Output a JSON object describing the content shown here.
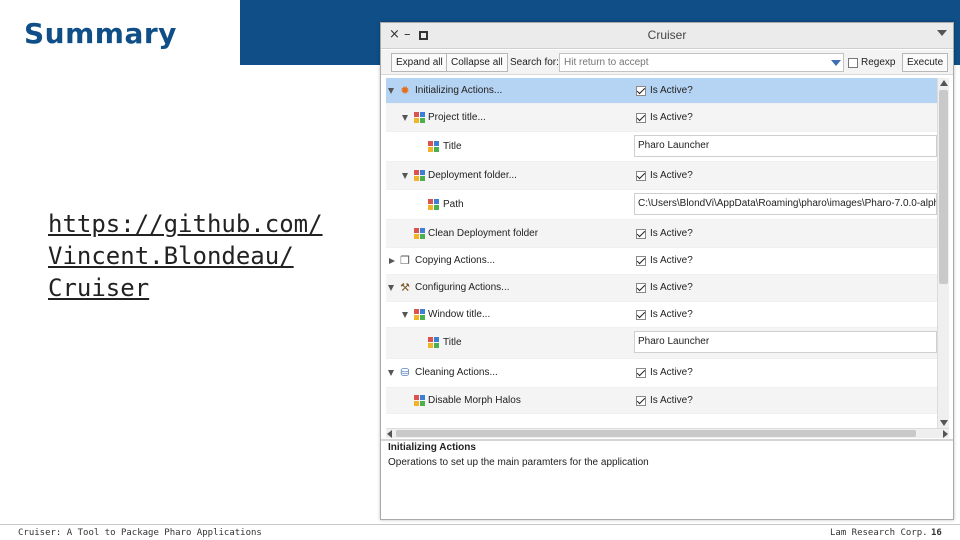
{
  "slide": {
    "title": "Summary",
    "link_lines": [
      "https://github.com/",
      "Vincent.Blondeau/",
      "Cruiser"
    ],
    "footer_left": "Cruiser: A Tool to Package Pharo Applications",
    "footer_company": "Lam Research Corp.",
    "page_number": "16",
    "header_color": "#0f4e86"
  },
  "window": {
    "title": "Cruiser",
    "close_glyph": "×",
    "minimize_glyph": "–",
    "toolbar": {
      "expand_all": "Expand all",
      "collapse_all": "Collapse all",
      "search_label": "Search for:",
      "search_placeholder": "Hit return to accept",
      "regexp_label": "Regexp",
      "execute": "Execute"
    },
    "tree": {
      "rows": [
        {
          "label": "Initializing Actions...",
          "check_label": "Is Active?",
          "icon": "gear-icon"
        },
        {
          "label": "Project title...",
          "check_label": "Is Active?",
          "icon": "grid-icon"
        },
        {
          "label": "Title",
          "field_value": "Pharo Launcher",
          "icon": "grid-icon"
        },
        {
          "label": "Deployment folder...",
          "check_label": "Is Active?",
          "icon": "grid-icon"
        },
        {
          "label": "Path",
          "field_value": "C:\\Users\\BlondVi\\AppData\\Roaming\\pharo\\images\\Pharo-7.0.0-alph",
          "icon": "grid-icon"
        },
        {
          "label": "Clean Deployment folder",
          "check_label": "Is Active?",
          "icon": "grid-icon"
        },
        {
          "label": "Copying Actions...",
          "check_label": "Is Active?",
          "icon": "copy-icon"
        },
        {
          "label": "Configuring Actions...",
          "check_label": "Is Active?",
          "icon": "wrench-icon"
        },
        {
          "label": "Window title...",
          "check_label": "Is Active?",
          "icon": "grid-icon"
        },
        {
          "label": "Title",
          "field_value": "Pharo Launcher",
          "icon": "grid-icon"
        },
        {
          "label": "Cleaning Actions...",
          "check_label": "Is Active?",
          "icon": "trash-icon"
        },
        {
          "label": "Disable Morph Halos",
          "check_label": "Is Active?",
          "icon": "grid-icon"
        }
      ]
    },
    "description": {
      "title": "Initializing Actions",
      "text": "Operations to set up the main paramters for the application"
    },
    "colors": {
      "selection": "#b5d3f2",
      "grid_icon": [
        "#d9534f",
        "#3d7fd4",
        "#f0b429",
        "#4caf50"
      ]
    }
  }
}
